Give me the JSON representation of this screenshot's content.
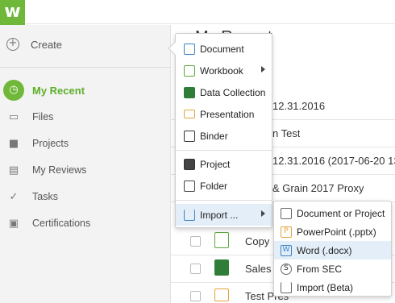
{
  "app": {
    "logo_text": "w",
    "brand_color": "#6fb83a"
  },
  "sidebar": {
    "create_label": "Create",
    "items": [
      {
        "label": "My Recent",
        "icon": "clock-icon",
        "active": true
      },
      {
        "label": "Files",
        "icon": "folder-icon"
      },
      {
        "label": "Projects",
        "icon": "briefcase-icon"
      },
      {
        "label": "My Reviews",
        "icon": "comment-icon"
      },
      {
        "label": "Tasks",
        "icon": "check-circle-icon"
      },
      {
        "label": "Certifications",
        "icon": "certificate-icon"
      }
    ]
  },
  "main": {
    "title": "My Recent",
    "rows": [
      {
        "name": "12.31.2016"
      },
      {
        "name": "n Test"
      },
      {
        "name": "12.31.2016 (2017-06-20 13"
      },
      {
        "name": "& Grain 2017 Proxy"
      },
      {
        "name": "Copy"
      },
      {
        "name": "Sales"
      },
      {
        "name": "Test Pres"
      }
    ]
  },
  "create_menu": {
    "items": [
      {
        "label": "Document",
        "icon": "document-icon"
      },
      {
        "label": "Workbook",
        "icon": "workbook-icon",
        "submenu": true
      },
      {
        "label": "Data Collection",
        "icon": "data-collection-icon"
      },
      {
        "label": "Presentation",
        "icon": "presentation-icon"
      },
      {
        "label": "Binder",
        "icon": "binder-icon"
      },
      {
        "label": "Project",
        "icon": "briefcase-icon"
      },
      {
        "label": "Folder",
        "icon": "folder-icon"
      },
      {
        "label": "Import ...",
        "icon": "import-icon",
        "submenu": true,
        "highlighted": true
      }
    ]
  },
  "import_submenu": {
    "items": [
      {
        "label": "Document or Project",
        "icon": "document-project-icon"
      },
      {
        "label": "PowerPoint (.pptx)",
        "icon": "powerpoint-icon"
      },
      {
        "label": "Word (.docx)",
        "icon": "word-icon",
        "highlighted": true
      },
      {
        "label": "From SEC",
        "icon": "sec-icon"
      },
      {
        "label": "Import (Beta)",
        "icon": "import-icon"
      }
    ]
  }
}
